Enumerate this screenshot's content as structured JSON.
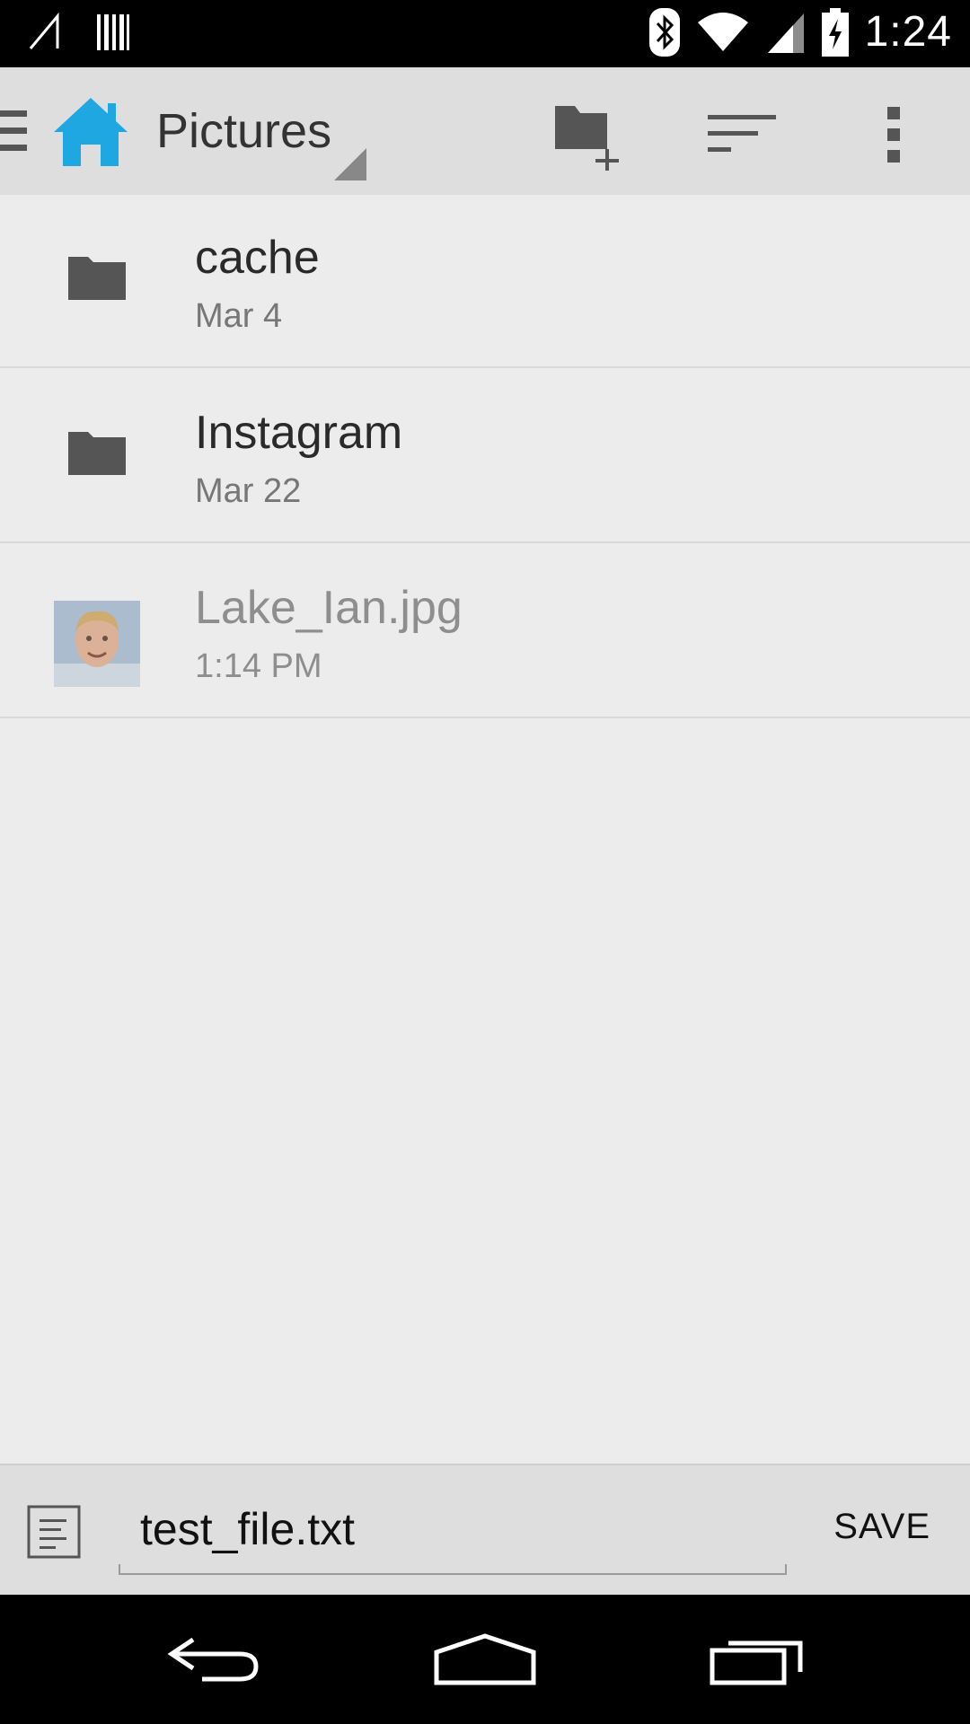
{
  "status_bar": {
    "time": "1:24",
    "icons": [
      "signal-off-icon",
      "barcode-icon",
      "bluetooth-icon",
      "wifi-icon",
      "cell-signal-icon",
      "battery-charging-icon"
    ]
  },
  "action_bar": {
    "title": "Pictures",
    "icons": [
      "drawer-icon",
      "home-icon",
      "new-folder-icon",
      "sort-icon",
      "overflow-menu-icon"
    ],
    "accent_color": "#1ea7e1"
  },
  "files": [
    {
      "name": "cache",
      "date": "Mar 4",
      "type": "folder",
      "icon": "folder-icon"
    },
    {
      "name": "Instagram",
      "date": "Mar 22",
      "type": "folder",
      "icon": "folder-icon"
    },
    {
      "name": "Lake_Ian.jpg",
      "date": "1:14 PM",
      "type": "image",
      "icon": "image-thumbnail"
    }
  ],
  "save_bar": {
    "filename_value": "test_file.txt",
    "save_label": "SAVE",
    "icon": "document-icon"
  },
  "nav_bar": {
    "icons": [
      "back-icon",
      "home-nav-icon",
      "recents-icon"
    ]
  }
}
